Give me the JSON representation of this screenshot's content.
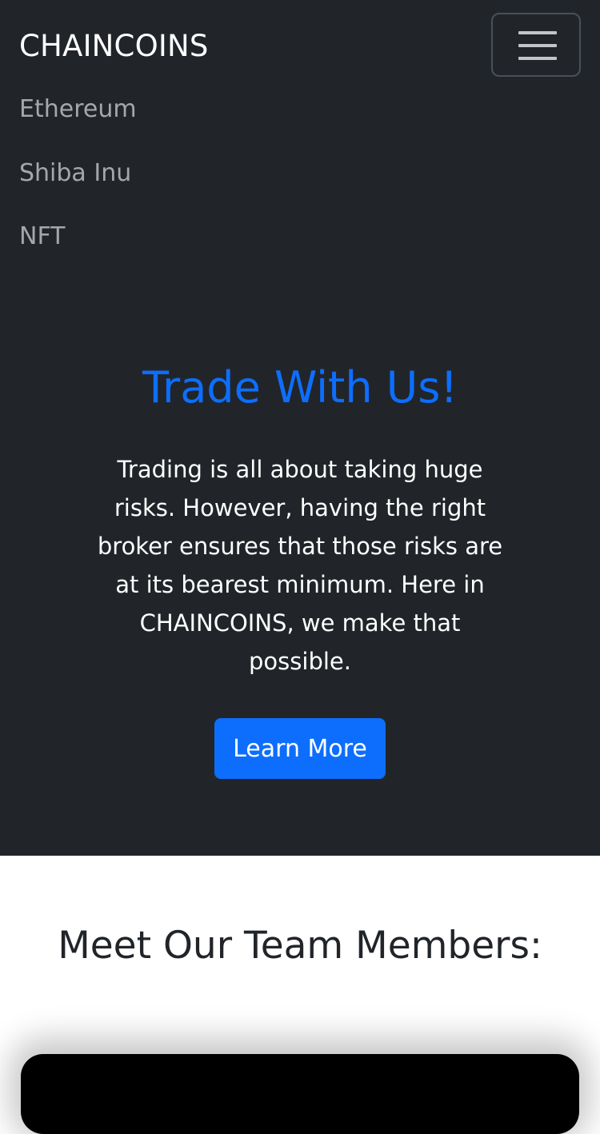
{
  "navbar": {
    "brand": "CHAINCOINS",
    "toggler_icon": "hamburger-icon",
    "links": [
      {
        "label": "Ethereum"
      },
      {
        "label": "Shiba Inu"
      },
      {
        "label": "NFT"
      }
    ]
  },
  "hero": {
    "title": "Trade With Us!",
    "text": "Trading is all about taking huge risks. However, having the right broker ensures that those risks are at its bearest minimum. Here in CHAINCOINS, we make that possible.",
    "button_label": "Learn More"
  },
  "team": {
    "title": "Meet Our Team Members:"
  },
  "colors": {
    "background_dark": "#212529",
    "accent": "#0d6efd",
    "nav_link": "#a5a7aa",
    "page_light": "#ffffff"
  }
}
